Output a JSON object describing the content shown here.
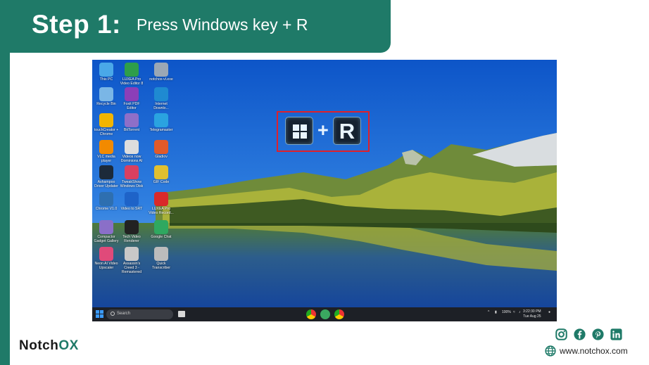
{
  "header": {
    "step_label": "Step 1:",
    "instruction": "Press Windows key + R"
  },
  "colors": {
    "brand": "#1f7a68",
    "highlight_border": "#e0202a"
  },
  "desktop": {
    "icons": [
      {
        "label": "This PC",
        "icon": "this-pc-icon",
        "color": "#4aa8e8"
      },
      {
        "label": "LUXEA Pro Video Editor 8",
        "icon": "luxea-editor-icon",
        "color": "#2e9e4a"
      },
      {
        "label": "notchox-vl.exe",
        "icon": "exe-file-icon",
        "color": "#9aa7b5"
      },
      {
        "label": "Recycle Bin",
        "icon": "recycle-bin-icon",
        "color": "#7ab6e6"
      },
      {
        "label": "Foxit PDF Editor",
        "icon": "foxit-pdf-icon",
        "color": "#8b3fb8"
      },
      {
        "label": "Internet Downlo...",
        "icon": "internet-download-icon",
        "color": "#1f8ad1"
      },
      {
        "label": "touchCreator + Chrome",
        "icon": "chrome-icon",
        "color": "#f2b500"
      },
      {
        "label": "BitTorrent",
        "icon": "bittorrent-icon",
        "color": "#8e6fc8"
      },
      {
        "label": "Telegramaster",
        "icon": "telegram-icon",
        "color": "#2aa3e0"
      },
      {
        "label": "VLC media player",
        "icon": "vlc-icon",
        "color": "#f28a00"
      },
      {
        "label": "Videos now Dominions AI",
        "icon": "film-reel-icon",
        "color": "#dddddd"
      },
      {
        "label": "Gladiov",
        "icon": "spark-icon",
        "color": "#e05a2a"
      },
      {
        "label": "Ashampoo Driver Updater",
        "icon": "driver-updater-icon",
        "color": "#1c2a3a"
      },
      {
        "label": "TweakShow Windows Disk",
        "icon": "disk-icon",
        "color": "#d94060"
      },
      {
        "label": "GIF Code",
        "icon": "gif-code-icon",
        "color": "#e0c030"
      },
      {
        "label": "Chrome V1.0",
        "icon": "compass-icon",
        "color": "#2e6fb0"
      },
      {
        "label": "Video to SRT",
        "icon": "video-srt-icon",
        "color": "#1e63c8"
      },
      {
        "label": "LUXEA Pro Video Record...",
        "icon": "video-recorder-icon",
        "color": "#d92a2a"
      },
      {
        "label": "Compactor Gadget Gallery",
        "icon": "gadget-icon",
        "color": "#8a6fc8"
      },
      {
        "label": "Tech Video Renderer",
        "icon": "text-renderer-icon",
        "color": "#222222"
      },
      {
        "label": "Google Chat",
        "icon": "google-chat-icon",
        "color": "#2fa860"
      },
      {
        "label": "Neon AI Video Upscaler",
        "icon": "upscaler-icon",
        "color": "#e04a7a"
      },
      {
        "label": "Assassin's Creed 3 - Remastered",
        "icon": "assassins-creed-icon",
        "color": "#c8c8c8"
      },
      {
        "label": "Quick Transcriber",
        "icon": "microphone-icon",
        "color": "#bcbcbc"
      }
    ],
    "shortcut": {
      "plus": "+",
      "key_letter": "R"
    }
  },
  "taskbar": {
    "search_placeholder": "Search",
    "battery": "100%",
    "time": "3:22:30 PM",
    "date": "Tue Aug 25"
  },
  "footer": {
    "logo_main": "Notch",
    "logo_accent": "OX",
    "socials": [
      {
        "icon": "instagram-icon"
      },
      {
        "icon": "facebook-icon"
      },
      {
        "icon": "pinterest-icon"
      },
      {
        "icon": "linkedin-icon"
      }
    ],
    "website": "www.notchox.com"
  }
}
